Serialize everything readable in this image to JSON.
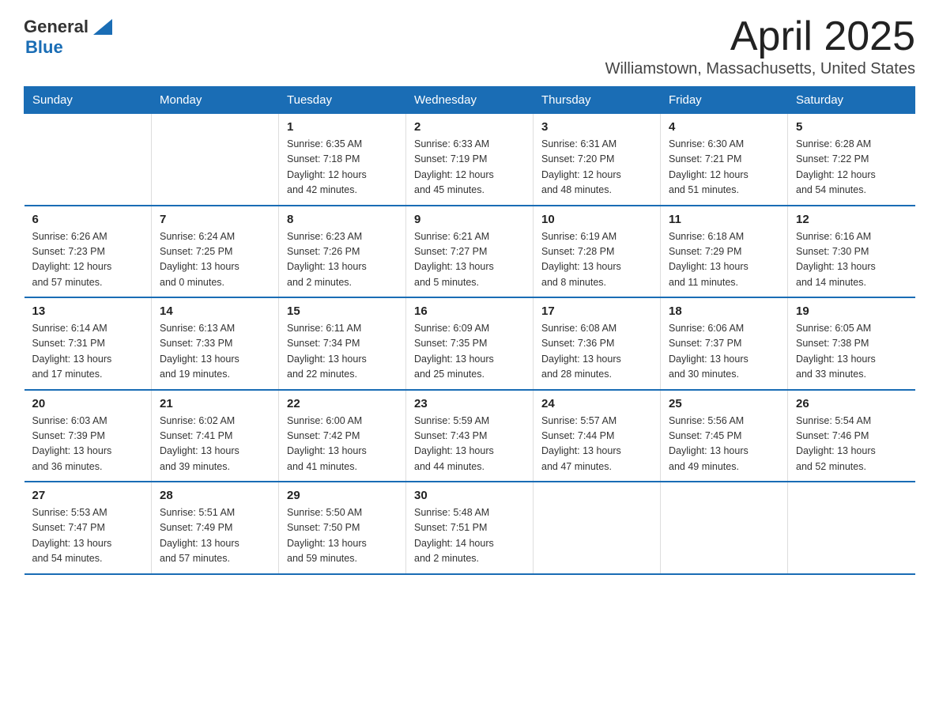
{
  "header": {
    "logo_general": "General",
    "logo_blue": "Blue",
    "month_title": "April 2025",
    "subtitle": "Williamstown, Massachusetts, United States"
  },
  "weekdays": [
    "Sunday",
    "Monday",
    "Tuesday",
    "Wednesday",
    "Thursday",
    "Friday",
    "Saturday"
  ],
  "weeks": [
    [
      {
        "day": "",
        "info": ""
      },
      {
        "day": "",
        "info": ""
      },
      {
        "day": "1",
        "info": "Sunrise: 6:35 AM\nSunset: 7:18 PM\nDaylight: 12 hours\nand 42 minutes."
      },
      {
        "day": "2",
        "info": "Sunrise: 6:33 AM\nSunset: 7:19 PM\nDaylight: 12 hours\nand 45 minutes."
      },
      {
        "day": "3",
        "info": "Sunrise: 6:31 AM\nSunset: 7:20 PM\nDaylight: 12 hours\nand 48 minutes."
      },
      {
        "day": "4",
        "info": "Sunrise: 6:30 AM\nSunset: 7:21 PM\nDaylight: 12 hours\nand 51 minutes."
      },
      {
        "day": "5",
        "info": "Sunrise: 6:28 AM\nSunset: 7:22 PM\nDaylight: 12 hours\nand 54 minutes."
      }
    ],
    [
      {
        "day": "6",
        "info": "Sunrise: 6:26 AM\nSunset: 7:23 PM\nDaylight: 12 hours\nand 57 minutes."
      },
      {
        "day": "7",
        "info": "Sunrise: 6:24 AM\nSunset: 7:25 PM\nDaylight: 13 hours\nand 0 minutes."
      },
      {
        "day": "8",
        "info": "Sunrise: 6:23 AM\nSunset: 7:26 PM\nDaylight: 13 hours\nand 2 minutes."
      },
      {
        "day": "9",
        "info": "Sunrise: 6:21 AM\nSunset: 7:27 PM\nDaylight: 13 hours\nand 5 minutes."
      },
      {
        "day": "10",
        "info": "Sunrise: 6:19 AM\nSunset: 7:28 PM\nDaylight: 13 hours\nand 8 minutes."
      },
      {
        "day": "11",
        "info": "Sunrise: 6:18 AM\nSunset: 7:29 PM\nDaylight: 13 hours\nand 11 minutes."
      },
      {
        "day": "12",
        "info": "Sunrise: 6:16 AM\nSunset: 7:30 PM\nDaylight: 13 hours\nand 14 minutes."
      }
    ],
    [
      {
        "day": "13",
        "info": "Sunrise: 6:14 AM\nSunset: 7:31 PM\nDaylight: 13 hours\nand 17 minutes."
      },
      {
        "day": "14",
        "info": "Sunrise: 6:13 AM\nSunset: 7:33 PM\nDaylight: 13 hours\nand 19 minutes."
      },
      {
        "day": "15",
        "info": "Sunrise: 6:11 AM\nSunset: 7:34 PM\nDaylight: 13 hours\nand 22 minutes."
      },
      {
        "day": "16",
        "info": "Sunrise: 6:09 AM\nSunset: 7:35 PM\nDaylight: 13 hours\nand 25 minutes."
      },
      {
        "day": "17",
        "info": "Sunrise: 6:08 AM\nSunset: 7:36 PM\nDaylight: 13 hours\nand 28 minutes."
      },
      {
        "day": "18",
        "info": "Sunrise: 6:06 AM\nSunset: 7:37 PM\nDaylight: 13 hours\nand 30 minutes."
      },
      {
        "day": "19",
        "info": "Sunrise: 6:05 AM\nSunset: 7:38 PM\nDaylight: 13 hours\nand 33 minutes."
      }
    ],
    [
      {
        "day": "20",
        "info": "Sunrise: 6:03 AM\nSunset: 7:39 PM\nDaylight: 13 hours\nand 36 minutes."
      },
      {
        "day": "21",
        "info": "Sunrise: 6:02 AM\nSunset: 7:41 PM\nDaylight: 13 hours\nand 39 minutes."
      },
      {
        "day": "22",
        "info": "Sunrise: 6:00 AM\nSunset: 7:42 PM\nDaylight: 13 hours\nand 41 minutes."
      },
      {
        "day": "23",
        "info": "Sunrise: 5:59 AM\nSunset: 7:43 PM\nDaylight: 13 hours\nand 44 minutes."
      },
      {
        "day": "24",
        "info": "Sunrise: 5:57 AM\nSunset: 7:44 PM\nDaylight: 13 hours\nand 47 minutes."
      },
      {
        "day": "25",
        "info": "Sunrise: 5:56 AM\nSunset: 7:45 PM\nDaylight: 13 hours\nand 49 minutes."
      },
      {
        "day": "26",
        "info": "Sunrise: 5:54 AM\nSunset: 7:46 PM\nDaylight: 13 hours\nand 52 minutes."
      }
    ],
    [
      {
        "day": "27",
        "info": "Sunrise: 5:53 AM\nSunset: 7:47 PM\nDaylight: 13 hours\nand 54 minutes."
      },
      {
        "day": "28",
        "info": "Sunrise: 5:51 AM\nSunset: 7:49 PM\nDaylight: 13 hours\nand 57 minutes."
      },
      {
        "day": "29",
        "info": "Sunrise: 5:50 AM\nSunset: 7:50 PM\nDaylight: 13 hours\nand 59 minutes."
      },
      {
        "day": "30",
        "info": "Sunrise: 5:48 AM\nSunset: 7:51 PM\nDaylight: 14 hours\nand 2 minutes."
      },
      {
        "day": "",
        "info": ""
      },
      {
        "day": "",
        "info": ""
      },
      {
        "day": "",
        "info": ""
      }
    ]
  ]
}
